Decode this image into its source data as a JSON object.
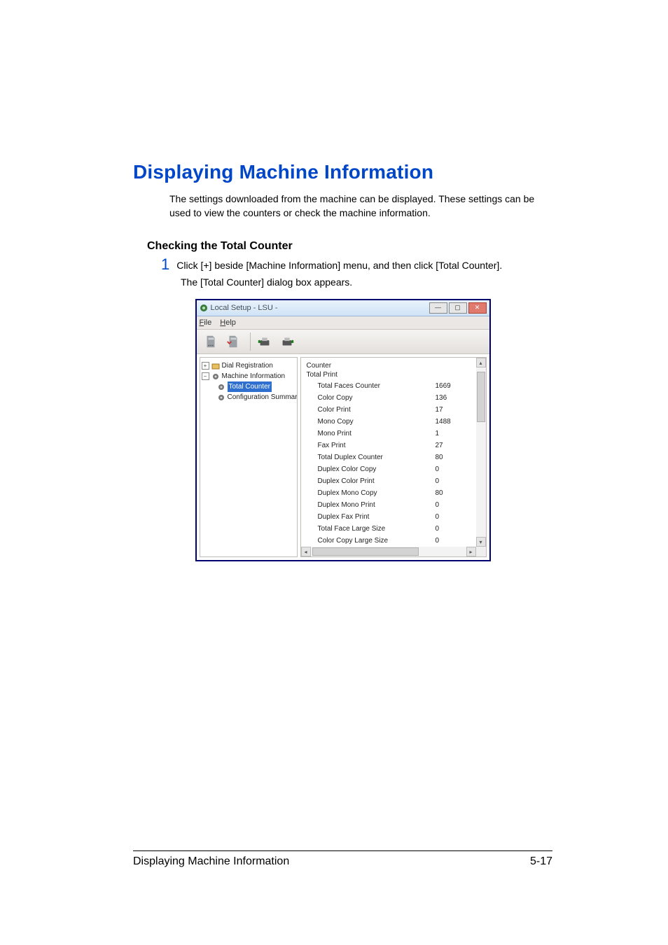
{
  "heading": "Displaying Machine Information",
  "intro": "The settings downloaded from the machine can be displayed. These settings can be used to view the counters or check the machine information.",
  "subheading": "Checking the Total Counter",
  "step_number": "1",
  "step_text": "Click [+] beside [Machine Information] menu, and then click [Total Counter].",
  "step_result": "The [Total Counter] dialog box appears.",
  "window": {
    "title": "Local Setup - LSU -",
    "menus": {
      "file": "File",
      "help": "Help"
    },
    "tree": {
      "dial_registration": "Dial Registration",
      "machine_information": "Machine Information",
      "total_counter": "Total Counter",
      "configuration_summary": "Configuration Summary"
    },
    "counter": {
      "header": "Counter",
      "group": "Total Print",
      "rows": [
        {
          "label": "Total Faces Counter",
          "value": "1669"
        },
        {
          "label": "Color Copy",
          "value": "136"
        },
        {
          "label": "Color Print",
          "value": "17"
        },
        {
          "label": "Mono Copy",
          "value": "1488"
        },
        {
          "label": "Mono Print",
          "value": "1"
        },
        {
          "label": "Fax Print",
          "value": "27"
        },
        {
          "label": "Total Duplex Counter",
          "value": "80"
        },
        {
          "label": "Duplex Color Copy",
          "value": "0"
        },
        {
          "label": "Duplex Color Print",
          "value": "0"
        },
        {
          "label": "Duplex Mono Copy",
          "value": "80"
        },
        {
          "label": "Duplex Mono Print",
          "value": "0"
        },
        {
          "label": "Duplex Fax Print",
          "value": "0"
        },
        {
          "label": "Total Face Large Size",
          "value": "0"
        },
        {
          "label": "Color Copy Large Size",
          "value": "0"
        }
      ]
    }
  },
  "footer": {
    "left": "Displaying Machine Information",
    "right": "5-17"
  }
}
